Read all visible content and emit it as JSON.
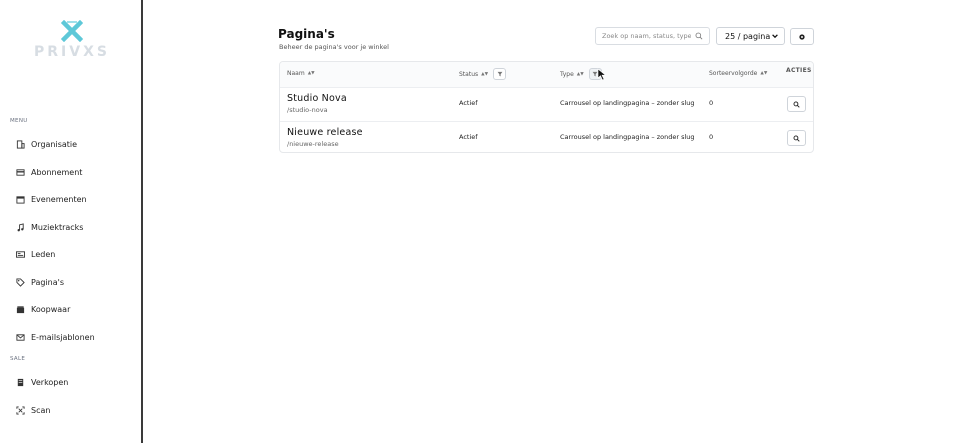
{
  "brand": {
    "name": "PRIVXS"
  },
  "sidebar": {
    "menu_label": "MENU",
    "sale_label": "SALE",
    "menu_items": [
      {
        "label": "Organisatie",
        "icon": "building-icon"
      },
      {
        "label": "Abonnement",
        "icon": "card-icon"
      },
      {
        "label": "Evenementen",
        "icon": "calendar-icon"
      },
      {
        "label": "Muziektracks",
        "icon": "music-icon"
      },
      {
        "label": "Leden",
        "icon": "id-card-icon"
      },
      {
        "label": "Pagina's",
        "icon": "tag-icon"
      },
      {
        "label": "Koopwaar",
        "icon": "box-icon"
      },
      {
        "label": "E-mailsjablonen",
        "icon": "envelope-icon"
      }
    ],
    "sale_items": [
      {
        "label": "Verkopen",
        "icon": "receipt-icon"
      },
      {
        "label": "Scan",
        "icon": "scan-icon"
      }
    ]
  },
  "header": {
    "title": "Pagina's",
    "subtitle": "Beheer de pagina's voor je winkel"
  },
  "toolbar": {
    "search_placeholder": "Zoek op naam, status, type",
    "per_page": "25 / pagina"
  },
  "table": {
    "columns": {
      "name": "Naam",
      "status": "Status",
      "type": "Type",
      "sort": "Sorteervolgorde",
      "actions": "ACTIES"
    },
    "rows": [
      {
        "name": "Studio Nova",
        "slug": "/studio-nova",
        "status": "Actief",
        "type": "Carrousel op landingpagina – zonder slug",
        "sort": "0"
      },
      {
        "name": "Nieuwe release",
        "slug": "/nieuwe-release",
        "status": "Actief",
        "type": "Carrousel op landingpagina – zonder slug",
        "sort": "0"
      }
    ]
  },
  "colors": {
    "brand_teal": "#5ec8d8",
    "border": "#cfd4da",
    "sidebar_divider": "#3a3a3a"
  }
}
